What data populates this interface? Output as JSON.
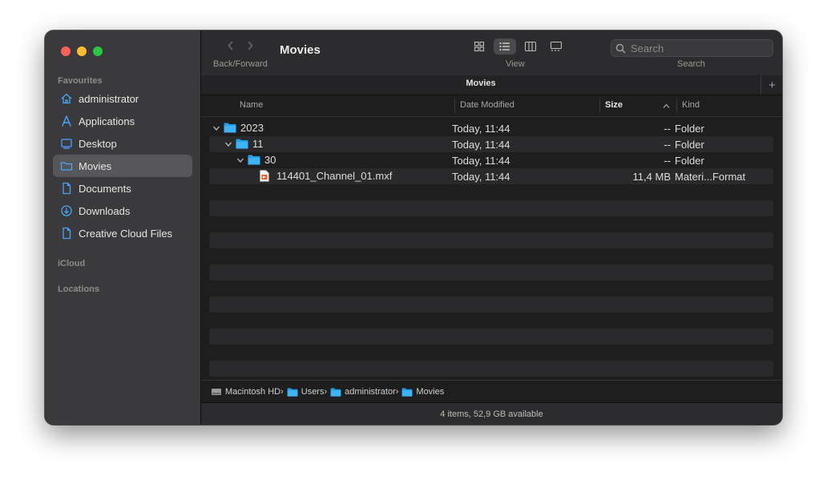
{
  "sidebar": {
    "sections": {
      "favourites": "Favourites",
      "icloud": "iCloud",
      "locations": "Locations"
    },
    "items": [
      {
        "label": "administrator",
        "icon": "home-icon"
      },
      {
        "label": "Applications",
        "icon": "applications-icon"
      },
      {
        "label": "Desktop",
        "icon": "desktop-icon"
      },
      {
        "label": "Movies",
        "icon": "folder-icon",
        "selected": true
      },
      {
        "label": "Documents",
        "icon": "document-icon"
      },
      {
        "label": "Downloads",
        "icon": "downloads-icon"
      },
      {
        "label": "Creative Cloud Files",
        "icon": "document-icon"
      }
    ]
  },
  "toolbar": {
    "title": "Movies",
    "back_forward_label": "Back/Forward",
    "view_label": "View",
    "search_label": "Search",
    "search_placeholder": "Search"
  },
  "tab": {
    "title": "Movies",
    "add": "+"
  },
  "columns": {
    "name": "Name",
    "date": "Date Modified",
    "size": "Size",
    "kind": "Kind"
  },
  "files": [
    {
      "name": "2023",
      "date": "Today, 11:44",
      "size": "--",
      "kind": "Folder",
      "type": "folder",
      "level": 0,
      "expanded": true
    },
    {
      "name": "11",
      "date": "Today, 11:44",
      "size": "--",
      "kind": "Folder",
      "type": "folder",
      "level": 1,
      "expanded": true
    },
    {
      "name": "30",
      "date": "Today, 11:44",
      "size": "--",
      "kind": "Folder",
      "type": "folder",
      "level": 2,
      "expanded": true
    },
    {
      "name": "114401_Channel_01.mxf",
      "date": "Today, 11:44",
      "size": "11,4 MB",
      "kind": "Materi...Format",
      "type": "file",
      "level": 3
    }
  ],
  "path": [
    "Macintosh HD",
    "Users",
    "administrator",
    "Movies"
  ],
  "status": "4 items, 52,9 GB available",
  "colors": {
    "folder": "#1ea0f0",
    "accent": "#4aa3ff"
  }
}
